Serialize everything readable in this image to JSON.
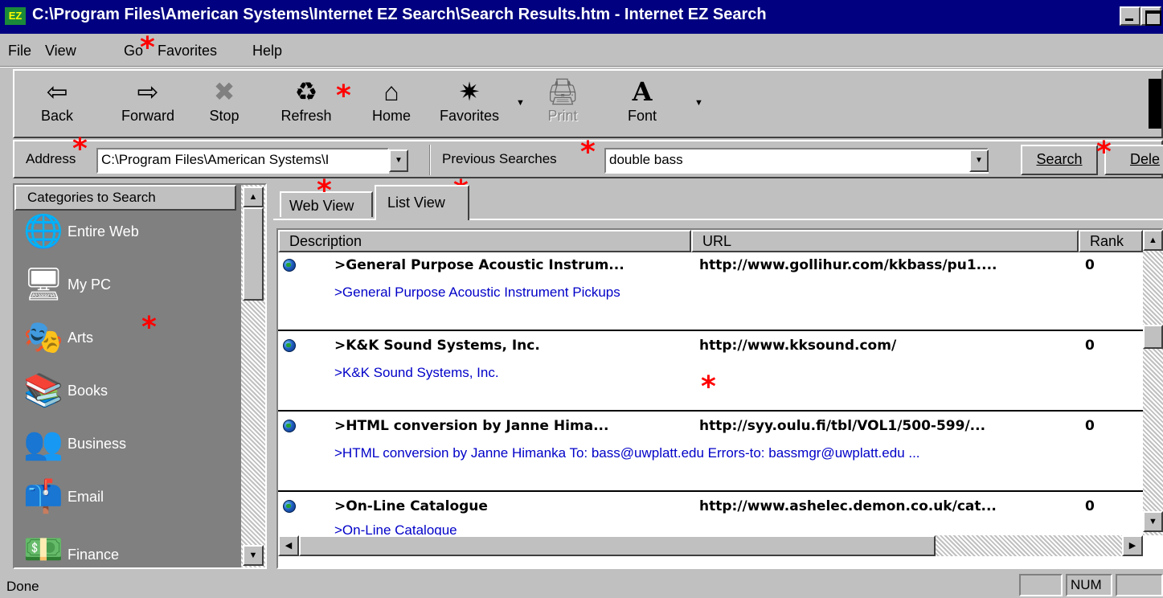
{
  "window": {
    "title": "C:\\Program Files\\American Systems\\Internet EZ Search\\Search Results.htm - Internet EZ Search",
    "app_icon": "EZ"
  },
  "menu": [
    "File",
    "View",
    "Go",
    "Favorites",
    "Help"
  ],
  "toolbar": {
    "back": {
      "label": "Back",
      "icon": "⇦"
    },
    "forward": {
      "label": "Forward",
      "icon": "⇨"
    },
    "stop": {
      "label": "Stop",
      "icon": "✖"
    },
    "refresh": {
      "label": "Refresh",
      "icon": "♻"
    },
    "home": {
      "label": "Home",
      "icon": "⌂"
    },
    "favorites": {
      "label": "Favorites",
      "icon": "✷"
    },
    "print": {
      "label": "Print",
      "icon": "🖨"
    },
    "font": {
      "label": "Font",
      "icon": "A"
    }
  },
  "address": {
    "label": "Address",
    "value": "C:\\Program Files\\American Systems\\I"
  },
  "previous_searches": {
    "label": "Previous Searches",
    "value": "double bass"
  },
  "buttons": {
    "search": "Search",
    "delete": "Dele"
  },
  "sidebar": {
    "header": "Categories to Search",
    "items": [
      {
        "label": "Entire Web",
        "icon": "🌐"
      },
      {
        "label": "My PC",
        "icon": "🖥"
      },
      {
        "label": "Arts",
        "icon": "🎭"
      },
      {
        "label": "Books",
        "icon": "📚"
      },
      {
        "label": "Business",
        "icon": "👥"
      },
      {
        "label": "Email",
        "icon": "📫"
      },
      {
        "label": "Finance",
        "icon": "💵"
      }
    ]
  },
  "tabs": {
    "web_view": "Web View",
    "list_view": "List View"
  },
  "results": {
    "columns": [
      "Description",
      "URL",
      "Rank"
    ],
    "rows": [
      {
        "title": ">General Purpose Acoustic Instrum...",
        "url": "http://www.gollihur.com/kkbass/pu1....",
        "rank": "0",
        "desc": ">General Purpose Acoustic Instrument Pickups"
      },
      {
        "title": ">K&K Sound Systems, Inc.",
        "url": "http://www.kksound.com/",
        "rank": "0",
        "desc": ">K&K Sound Systems, Inc."
      },
      {
        "title": ">HTML conversion by Janne Hima...",
        "url": "http://syy.oulu.fi/tbl/VOL1/500-599/...",
        "rank": "0",
        "desc": ">HTML conversion by Janne Himanka To: bass@uwplatt.edu Errors-to: bassmgr@uwplatt.edu ..."
      },
      {
        "title": ">On-Line Catalogue",
        "url": "http://www.ashelec.demon.co.uk/cat...",
        "rank": "0",
        "desc": ">On-Line Catalogue"
      }
    ]
  },
  "status": {
    "text": "Done",
    "num": "NUM"
  },
  "marker": "*"
}
